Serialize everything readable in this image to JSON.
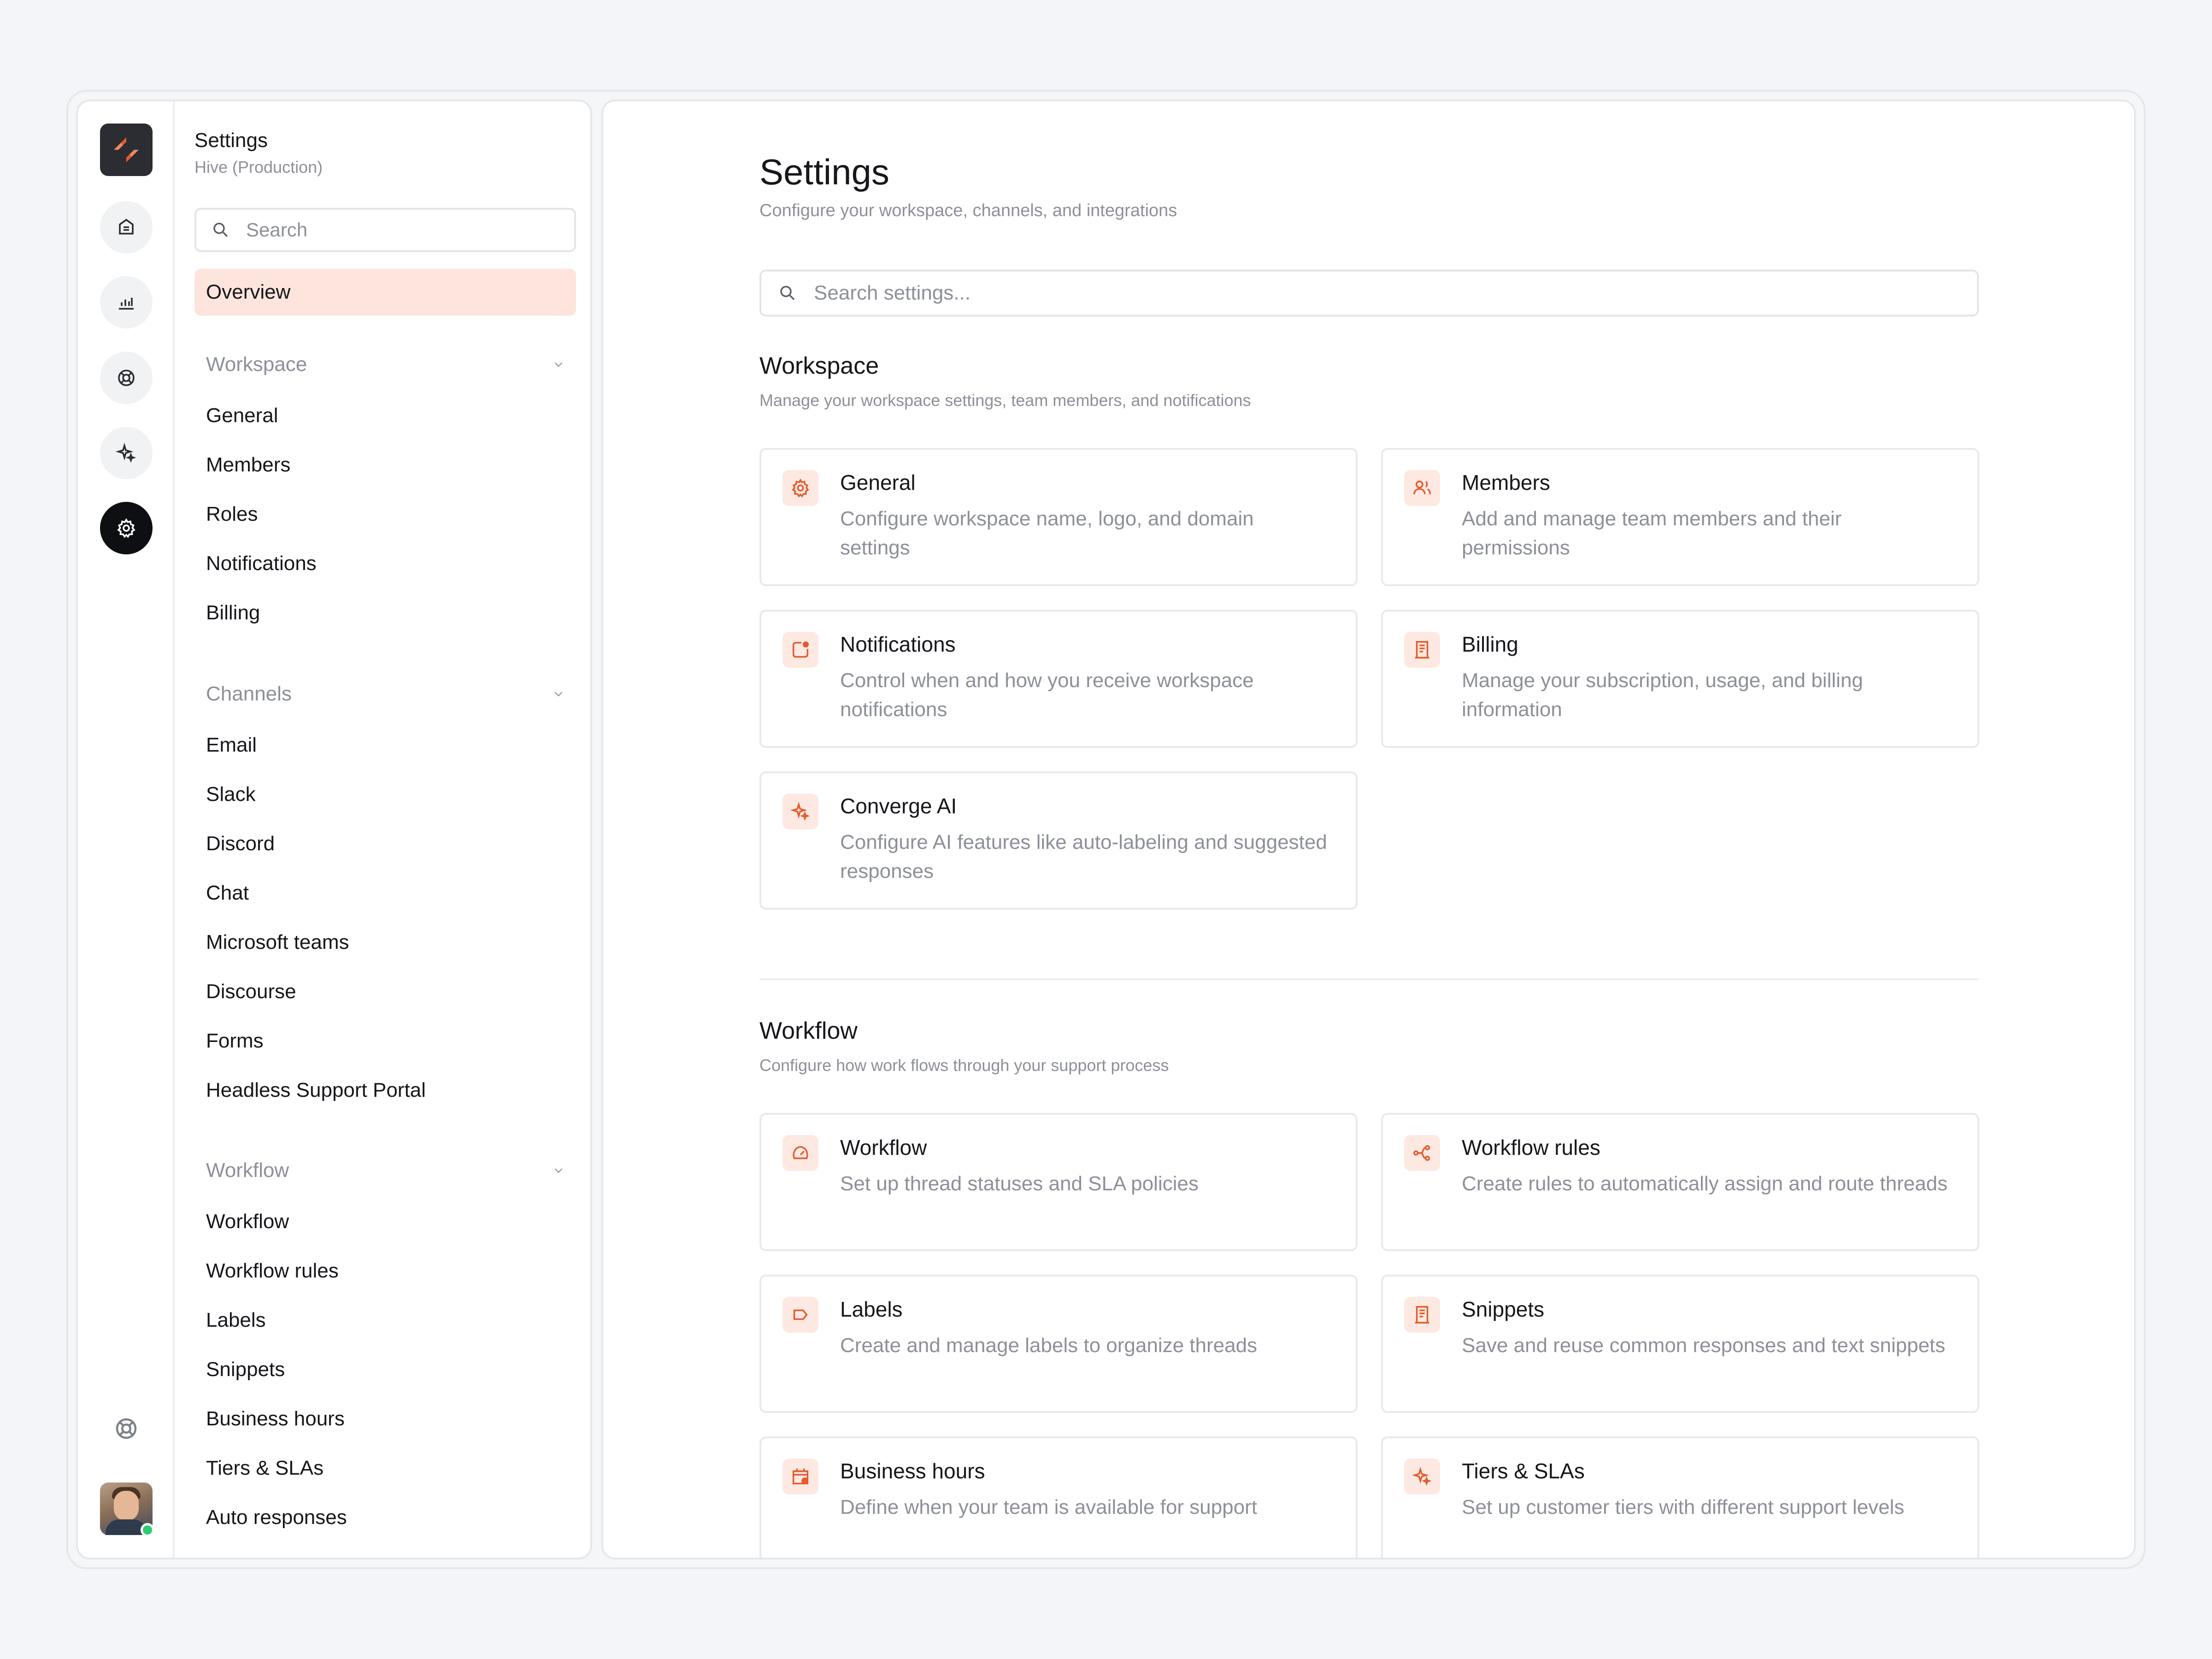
{
  "app": {
    "title": "Settings",
    "workspace": "Hive (Production)"
  },
  "rail": {
    "icons": [
      "logo-icon",
      "inbox-icon",
      "analytics-icon",
      "support-icon",
      "sparkle-icon",
      "settings-icon",
      "help-icon",
      "avatar"
    ],
    "active": "settings-icon"
  },
  "nav": {
    "search_placeholder": "Search",
    "overview": "Overview",
    "groups": [
      {
        "label": "Workspace",
        "items": [
          "General",
          "Members",
          "Roles",
          "Notifications",
          "Billing"
        ]
      },
      {
        "label": "Channels",
        "items": [
          "Email",
          "Slack",
          "Discord",
          "Chat",
          "Microsoft teams",
          "Discourse",
          "Forms",
          "Headless Support Portal"
        ]
      },
      {
        "label": "Workflow",
        "items": [
          "Workflow",
          "Workflow rules",
          "Labels",
          "Snippets",
          "Business hours",
          "Tiers & SLAs",
          "Auto responses"
        ]
      }
    ]
  },
  "main": {
    "title": "Settings",
    "subtitle": "Configure your workspace, channels, and integrations",
    "search_placeholder": "Search settings...",
    "sections": [
      {
        "title": "Workspace",
        "subtitle": "Manage your workspace settings, team members, and notifications",
        "cards": [
          {
            "title": "General",
            "desc": "Configure workspace name, logo, and domain settings",
            "icon": "gear-icon"
          },
          {
            "title": "Members",
            "desc": "Add and manage team members and their permissions",
            "icon": "members-icon"
          },
          {
            "title": "Notifications",
            "desc": "Control when and how you receive workspace notifications",
            "icon": "notification-icon"
          },
          {
            "title": "Billing",
            "desc": "Manage your subscription, usage, and billing information",
            "icon": "receipt-icon"
          },
          {
            "title": "Converge AI",
            "desc": "Configure AI features like auto-labeling and suggested responses",
            "icon": "sparkle-icon"
          }
        ]
      },
      {
        "title": "Workflow",
        "subtitle": "Configure how work flows through your support process",
        "cards": [
          {
            "title": "Workflow",
            "desc": "Set up thread statuses and SLA policies",
            "icon": "gauge-icon"
          },
          {
            "title": "Workflow rules",
            "desc": "Create rules to automatically assign and route threads",
            "icon": "route-icon"
          },
          {
            "title": "Labels",
            "desc": "Create and manage labels to organize threads",
            "icon": "label-icon"
          },
          {
            "title": "Snippets",
            "desc": "Save and reuse common responses and text snippets",
            "icon": "snippet-icon"
          },
          {
            "title": "Business hours",
            "desc": "Define when your team is available for support",
            "icon": "calendar-icon"
          },
          {
            "title": "Tiers & SLAs",
            "desc": "Set up customer tiers with different support levels",
            "icon": "sparkle-icon"
          }
        ]
      }
    ]
  },
  "colors": {
    "accent": "#e35a2c",
    "accent_bg": "#fde9e2",
    "active_nav_bg": "#fde5dd",
    "online": "#2dcb74"
  }
}
